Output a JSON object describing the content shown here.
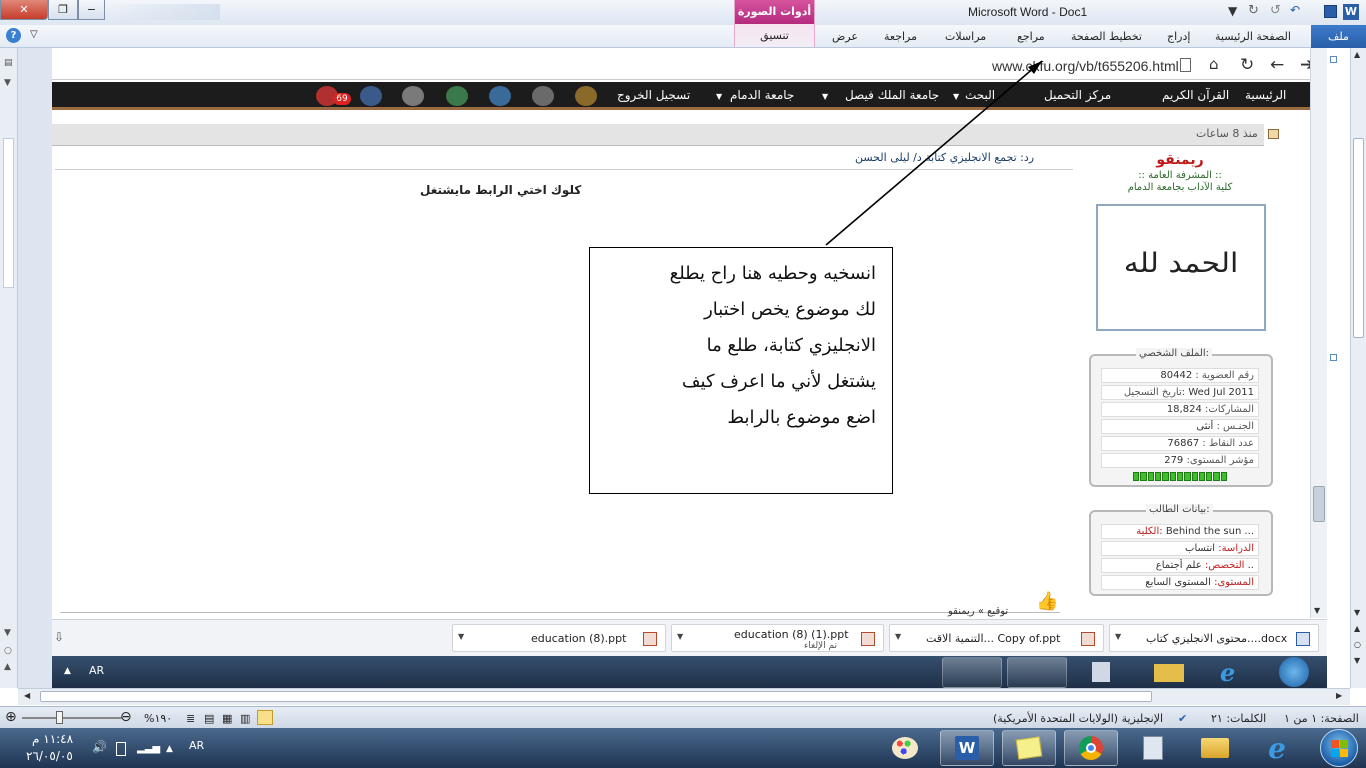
{
  "window": {
    "title": "Microsoft Word - Doc1",
    "picture_tools": "أدوات الصورة",
    "picture_tools_tab": "تنسيق"
  },
  "ribbon": {
    "file": "ملف",
    "tabs": [
      "الصفحة الرئيسية",
      "إدراج",
      "تخطيط الصفحة",
      "مراجع",
      "مراسلات",
      "مراجعة",
      "عرض"
    ]
  },
  "browser": {
    "url": "www.ckfu.org/vb/t655206.html",
    "nav": [
      "الرئيسية",
      "القرآن الكريم",
      "مركز التحميل",
      "البحث",
      "جامعة الملك فيصل",
      "جامعة الدمام",
      "تسجيل الخروج"
    ],
    "badge": "69"
  },
  "post": {
    "time_ago": "منذ 8 ساعات",
    "title": "رد: تجمع الانجليزي كتابة د/ ليلى الحسن",
    "body": "كلوك اختي الرابط مايشتغل",
    "signature": "توقيع » ريمنقو"
  },
  "user": {
    "name": "ريمنقو",
    "role": ":: المشرفة العامة ::",
    "college": "كلية الآداب بجامعة الدمام",
    "avatar_text": "الحمد لله",
    "profile_title": "الملف الشخصي:",
    "profile": [
      {
        "k": "رقم العضوية :",
        "v": "80442"
      },
      {
        "k": "تاريخ التسجيل:",
        "v": "Wed Jul 2011"
      },
      {
        "k": "المشاركات:",
        "v": "18,824"
      },
      {
        "k": "الجنـس :",
        "v": "أنثى"
      },
      {
        "k": "عدد النقاط :",
        "v": "76867"
      },
      {
        "k": "مؤشر المستوى:",
        "v": "279"
      }
    ],
    "level_segments": 13,
    "student_title": "بيانات الطالب:",
    "student": [
      {
        "k": "الكلية:",
        "v": "Behind the sun ..."
      },
      {
        "k": "الدراسة:",
        "v": "انتساب"
      },
      {
        "k": "التخصص:",
        "v": "علم أجتماع .."
      },
      {
        "k": "المستوى:",
        "v": "المستوى السابع"
      }
    ]
  },
  "callout": {
    "lines": [
      "انسخيه وحطيه هنا راح يطلع",
      "لك موضوع يخص اختبار",
      "الانجليزي كتابة، طلع ما",
      "يشتغل لأني ما اعرف كيف",
      "اضع موضوع بالرابط"
    ]
  },
  "downloads": [
    {
      "name": "محتوى الانجليزي كتاب....docx"
    },
    {
      "name": "التنمية الاقت... Copy of.ppt"
    },
    {
      "name": "education (8) (1).ppt",
      "sub": "تم الإلغاء"
    },
    {
      "name": "education (8).ppt"
    }
  ],
  "inner_taskbar": {
    "lang": "AR"
  },
  "status": {
    "page": "الصفحة: ١ من ١",
    "words": "الكلمات: ٢١",
    "language": "الإنجليزية (الولايات المتحدة الأمريكية)",
    "zoom": "%١٩٠"
  },
  "taskbar": {
    "time": "١١:٤٨ م",
    "date": "٢٦/٠٥/٠٥",
    "lang": "AR"
  }
}
